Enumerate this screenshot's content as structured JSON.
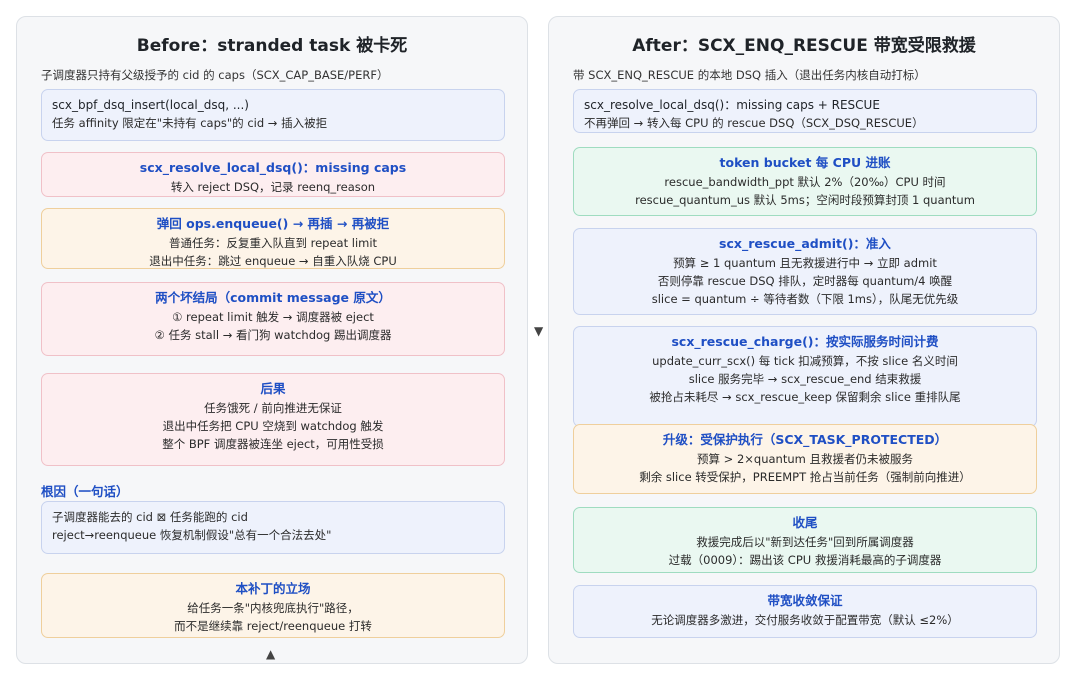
{
  "left": {
    "title": "Before：stranded task 被卡死",
    "note": "子调度器只持有父级授予的 cid 的 caps（SCX_CAP_BASE/PERF）",
    "insert_box": {
      "line1": "scx_bpf_dsq_insert(local_dsq, ...)",
      "line2": "任务 affinity 限定在\"未持有 caps\"的 cid → 插入被拒"
    },
    "resolve_box": {
      "head": "scx_resolve_local_dsq()：missing caps",
      "line1": "转入 reject DSQ，记录 reenq_reason"
    },
    "bounce_box": {
      "head": "弹回 ops.enqueue() → 再插 → 再被拒",
      "line1": "普通任务：反复重入队直到 repeat limit",
      "line2": "退出中任务：跳过 enqueue → 自重入队烧 CPU"
    },
    "outcome_box": {
      "head": "两个坏结局（commit message 原文）",
      "line1": "① repeat limit 触发 → 调度器被 eject",
      "line2": "② 任务 stall → 看门狗 watchdog 踢出调度器"
    },
    "consequence_box": {
      "head": "后果",
      "line1": "任务饿死 / 前向推进无保证",
      "line2": "退出中任务把 CPU 空烧到 watchdog 触发",
      "line3": "整个 BPF 调度器被连坐 eject，可用性受损"
    },
    "root_label": "根因（一句话）",
    "root_box": {
      "line1": "子调度器能去的 cid ⊠ 任务能跑的 cid",
      "line2": "reject→reenqueue 恢复机制假设\"总有一个合法去处\""
    },
    "stance_box": {
      "head": "本补丁的立场",
      "line1": "给任务一条\"内核兜底执行\"路径，",
      "line2": "而不是继续靠 reject/reenqueue 打转"
    },
    "arrow_up": "▲"
  },
  "right": {
    "title": "After：SCX_ENQ_RESCUE 带宽受限救援",
    "note": "带 SCX_ENQ_RESCUE 的本地 DSQ 插入（退出任务内核自动打标）",
    "resolve_box": {
      "line1": "scx_resolve_local_dsq()：missing caps + RESCUE",
      "line2": "不再弹回 → 转入每 CPU 的 rescue DSQ（SCX_DSQ_RESCUE）"
    },
    "token_box": {
      "head": "token bucket 每 CPU 进账",
      "line1": "rescue_bandwidth_ppt 默认 2%（20‰）CPU 时间",
      "line2": "rescue_quantum_us 默认 5ms；空闲时段预算封顶 1 quantum"
    },
    "admit_box": {
      "head": "scx_rescue_admit()：准入",
      "line1": "预算 ≥ 1 quantum 且无救援进行中 → 立即 admit",
      "line2": "否则停靠 rescue DSQ 排队，定时器每 quantum/4 唤醒",
      "line3": "slice = quantum ÷ 等待者数（下限 1ms），队尾无优先级"
    },
    "charge_box": {
      "head": "scx_rescue_charge()：按实际服务时间计费",
      "line1": "update_curr_scx() 每 tick 扣减预算，不按 slice 名义时间",
      "line2": "slice 服务完毕 → scx_rescue_end 结束救援",
      "line3": "被抢占未耗尽 → scx_rescue_keep 保留剩余 slice 重排队尾"
    },
    "upgrade_box": {
      "head": "升级：受保护执行（SCX_TASK_PROTECTED）",
      "line1": "预算 > 2×quantum 且救援者仍未被服务",
      "line2": "剩余 slice 转受保护，PREEMPT 抢占当前任务（强制前向推进）"
    },
    "finish_box": {
      "head": "收尾",
      "line1": "救援完成后以\"新到达任务\"回到所属调度器",
      "line2": "过载（0009）：踢出该 CPU 救援消耗最高的子调度器"
    },
    "guarantee_box": {
      "head": "带宽收敛保证",
      "line1": "无论调度器多激进，交付服务收敛于配置带宽（默认 ≤2%）"
    }
  },
  "mid_arrow": "▼"
}
